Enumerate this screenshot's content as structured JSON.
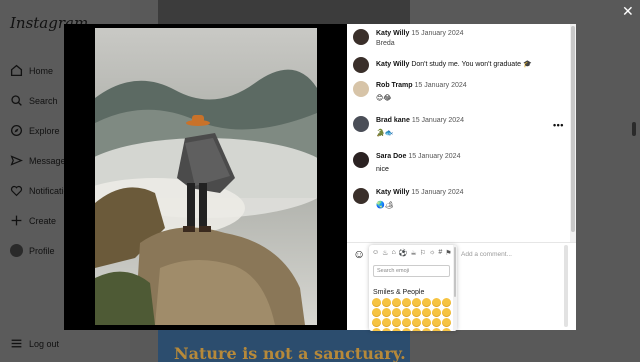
{
  "app": {
    "logo": "Instagram"
  },
  "nav": {
    "items": [
      {
        "label": "Home",
        "icon": "home-icon"
      },
      {
        "label": "Search",
        "icon": "search-icon"
      },
      {
        "label": "Explore",
        "icon": "compass-icon"
      },
      {
        "label": "Messages",
        "icon": "send-icon"
      },
      {
        "label": "Notifications",
        "icon": "heart-icon"
      },
      {
        "label": "Create",
        "icon": "plus-icon"
      },
      {
        "label": "Profile",
        "icon": "avatar"
      }
    ],
    "logout": "Log out"
  },
  "feed": {
    "caption": "Nature is not a sanctuary."
  },
  "modal": {
    "close": "✕",
    "comments": [
      {
        "name": "Katy Willy",
        "date": "15 January 2024",
        "text": "Breda",
        "avatar_color": "#3a2f2a"
      },
      {
        "name": "Katy Willy",
        "date": "",
        "text": "Don't study me. You won't graduate 🎓",
        "avatar_color": "#3a2f2a"
      },
      {
        "name": "Rob Tramp",
        "date": "15 January 2024",
        "text": "😊😂",
        "avatar_color": "#d7c4a8"
      },
      {
        "name": "Brad kane",
        "date": "15 January 2024",
        "text": "🐊🐟",
        "avatar_color": "#4a4e57"
      },
      {
        "name": "Sara Doe",
        "date": "15 January 2024",
        "text": "nice",
        "avatar_color": "#2b2222"
      },
      {
        "name": "Katy Willy",
        "date": "15 January 2024",
        "text": "🌏🏕",
        "avatar_color": "#3a2f2a"
      }
    ],
    "more": "•••",
    "composer": {
      "placeholder": "Add a comment...",
      "emoji_search_placeholder": "Search emoji",
      "emoji_category": "Smiles & People",
      "emoji_tabs": [
        "☺",
        "♨",
        "⌂",
        "⚽",
        "☕",
        "⚐",
        "☼",
        "#",
        "⚑"
      ]
    }
  }
}
